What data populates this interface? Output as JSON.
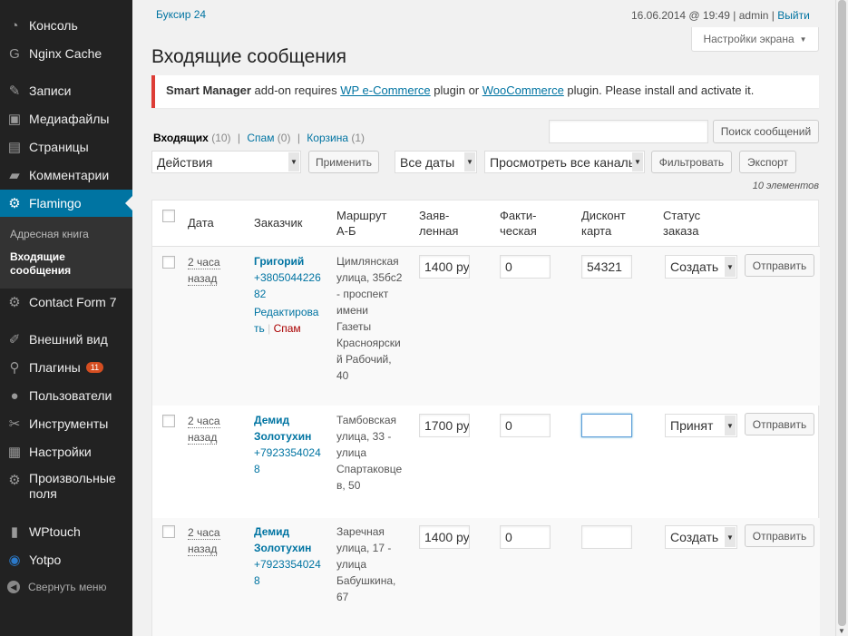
{
  "sidebar": {
    "items": [
      {
        "label": "Консоль",
        "icon": "dashboard-icon"
      },
      {
        "label": "Nginx Cache",
        "icon": "nginx-icon"
      },
      {
        "label": "Записи",
        "icon": "pin-icon"
      },
      {
        "label": "Медиафайлы",
        "icon": "media-icon"
      },
      {
        "label": "Страницы",
        "icon": "pages-icon"
      },
      {
        "label": "Комментарии",
        "icon": "comment-icon"
      },
      {
        "label": "Flamingo",
        "icon": "gear-icon"
      },
      {
        "label": "Contact Form 7",
        "icon": "gear-icon"
      },
      {
        "label": "Внешний вид",
        "icon": "brush-icon"
      },
      {
        "label": "Плагины",
        "icon": "plugin-icon",
        "badge": "11"
      },
      {
        "label": "Пользователи",
        "icon": "user-icon"
      },
      {
        "label": "Инструменты",
        "icon": "wrench-icon"
      },
      {
        "label": "Настройки",
        "icon": "settings-icon"
      },
      {
        "label": "Произвольные поля",
        "icon": "gear-icon"
      },
      {
        "label": "WPtouch",
        "icon": "phone-icon"
      },
      {
        "label": "Yotpo",
        "icon": "yotpo-icon"
      }
    ],
    "submenu": {
      "address_book": "Адресная книга",
      "inbox": "Входящие сообщения"
    },
    "collapse": "Свернуть меню"
  },
  "topbar": {
    "site": "Буксир 24",
    "datetime": "16.06.2014 @ 19:49",
    "sep": "|",
    "user": "admin",
    "logout": "Выйти"
  },
  "screen_options": "Настройки экрана",
  "page_title": "Входящие сообщения",
  "notice": {
    "plugin": "Smart Manager",
    "text1": " add-on requires ",
    "link1": "WP e-Commerce",
    "text2": " plugin or ",
    "link2": "WooCommerce",
    "text3": " plugin. Please install and activate it."
  },
  "filters": {
    "inbox": "Входящих",
    "inbox_count": "(10)",
    "spam": "Спам",
    "spam_count": "(0)",
    "trash": "Корзина",
    "trash_count": "(1)",
    "sep": "|"
  },
  "search": {
    "value": "",
    "button": "Поиск сообщений"
  },
  "toolbar": {
    "actions": "Действия",
    "apply": "Применить",
    "dates": "Все даты",
    "channels": "Просмотреть все каналы",
    "filter": "Фильтровать",
    "export": "Экспорт",
    "count": "10 элементов"
  },
  "table": {
    "headers": {
      "date": "Дата",
      "customer": "Заказчик",
      "route": "Маршрут А-Б",
      "declared_1": "Заяв-",
      "declared_2": "ленная",
      "actual_1": "Факти-",
      "actual_2": "ческая",
      "discount_1": "Дисконт",
      "discount_2": "карта",
      "status_1": "Статус",
      "status_2": "заказа"
    },
    "rows": [
      {
        "date1": "2 часа",
        "date2": "назад",
        "name": "Григорий",
        "phone": "+380504422682",
        "edit": "Редактировать",
        "sep": "|",
        "spam": "Спам",
        "route": "Цимлянская улица, 35бс2 - проспект имени Газеты Красноярский Рабочий, 40",
        "declared": "1400 ру",
        "actual": "0",
        "discount": "54321",
        "status": "Создать",
        "send": "Отправить"
      },
      {
        "date1": "2 часа",
        "date2": "назад",
        "name": "Демид Золотухин",
        "phone": "+79233540248",
        "route": "Тамбовская улица, 33 - улица Спартаковцев, 50",
        "declared": "1700 ру",
        "actual": "0",
        "discount": "",
        "status": "Принят",
        "send": "Отправить"
      },
      {
        "date1": "2 часа",
        "date2": "назад",
        "name": "Демид Золотухин",
        "phone": "+79233540248",
        "route": "Заречная улица, 17 - улица Бабушкина, 67",
        "declared": "1400 ру",
        "actual": "0",
        "discount": "",
        "status": "Создать",
        "send": "Отправить"
      }
    ]
  },
  "colors": {
    "sidebar_bg": "#222222",
    "active_bg": "#0074a2",
    "link": "#0074a2",
    "notice_border": "#dd3d36",
    "spam": "#a00000",
    "badge": "#d54e21"
  }
}
